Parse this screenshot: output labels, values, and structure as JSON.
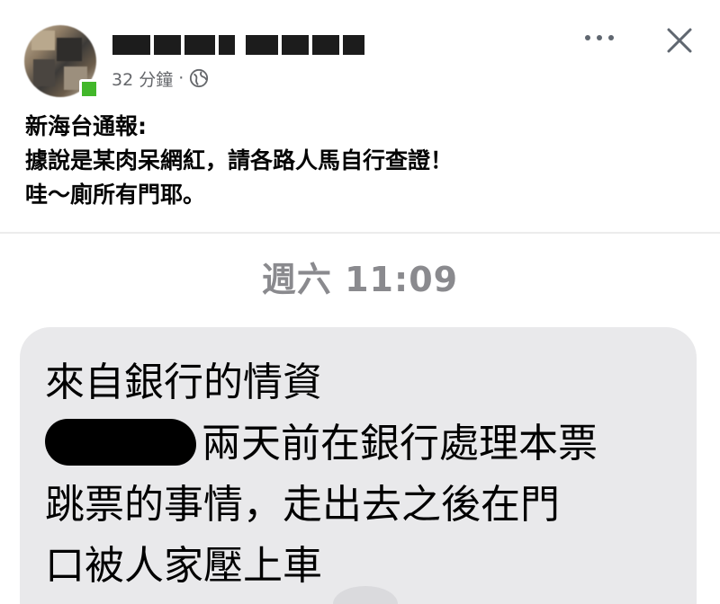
{
  "post": {
    "time_ago": "32 分鐘",
    "separator": "·",
    "text_lines": [
      "新海台通報:",
      "據說是某肉呆網紅，請各路人馬自行查證！",
      "哇～廁所有門耶。"
    ]
  },
  "icons": {
    "privacy": "globe-icon",
    "menu": "more-icon",
    "close": "close-icon"
  },
  "shared_image": {
    "chat_time": "週六 11:09",
    "bubble_lines": [
      "來自銀行的情資",
      "兩天前在銀行處理本票",
      "跳票的事情，走出去之後在門",
      "口被人家壓上車"
    ]
  },
  "colors": {
    "meta_gray": "#65676b",
    "online_green": "#42b72a",
    "bubble_gray": "#e9e9eb",
    "time_gray": "#8a8a8e"
  }
}
